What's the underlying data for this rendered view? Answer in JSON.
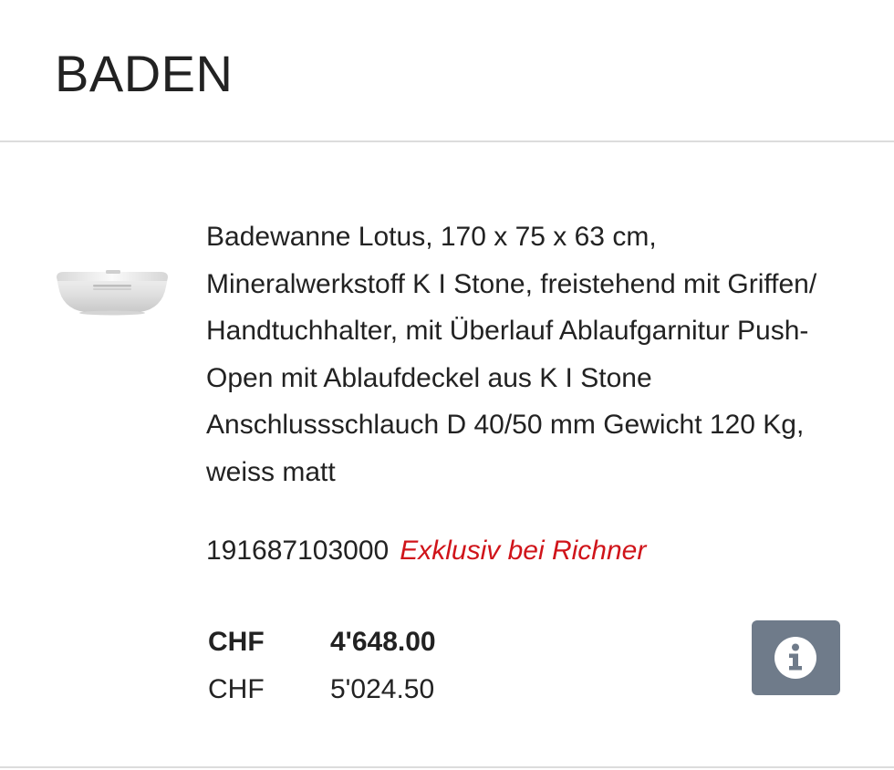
{
  "category": {
    "title": "BADEN"
  },
  "product": {
    "description": "Badewanne Lotus, 170 x 75 x 63 cm, Mineralwerkstoff K I Stone, freistehend mit Griffen/ Handtuchhalter, mit Überlauf Ablaufgarnitur Push-Open mit Ablaufdeckel aus K I Stone Anschlussschlauch D 40/50 mm Gewicht 120 Kg, weiss matt",
    "sku": "191687103000",
    "exclusive_label": "Exklusiv bei Richner",
    "image_icon": "bathtub-image",
    "prices": [
      {
        "currency": "CHF",
        "amount": "4'648.00"
      },
      {
        "currency": "CHF",
        "amount": "5'024.50"
      }
    ],
    "info_icon": "info-icon"
  },
  "colors": {
    "text": "#222222",
    "accent_red": "#d0141a",
    "info_button_bg": "#6f7b8a",
    "divider": "#dcdcdc"
  }
}
